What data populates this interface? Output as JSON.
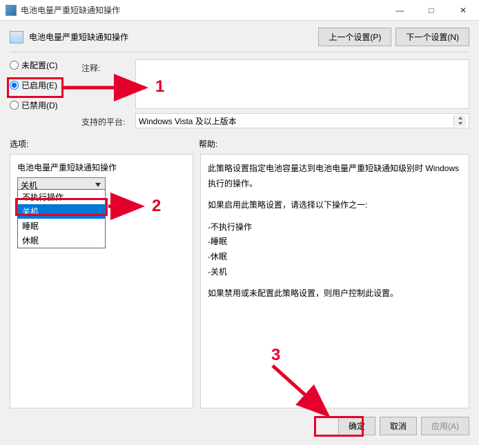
{
  "window": {
    "title": "电池电量严重短缺通知操作",
    "minimize": "—",
    "maximize": "□",
    "close": "✕"
  },
  "header": {
    "title": "电池电量严重短缺通知操作",
    "prev_btn": "上一个设置(P)",
    "next_btn": "下一个设置(N)"
  },
  "radios": {
    "not_configured": "未配置(C)",
    "enabled": "已启用(E)",
    "disabled": "已禁用(D)"
  },
  "fields": {
    "comment_label": "注释:",
    "comment_value": "",
    "platform_label": "支持的平台:",
    "platform_value": "Windows Vista 及以上版本"
  },
  "sections": {
    "options_label": "选项:",
    "help_label": "帮助:"
  },
  "options_panel": {
    "title": "电池电量严重短缺通知操作",
    "combo_selected": "关机",
    "combo_items": [
      "不执行操作",
      "关机",
      "睡眠",
      "休眠"
    ]
  },
  "help_panel": {
    "p1": "此策略设置指定电池容量达到电池电量严重短缺通知级别时 Windows 执行的操作。",
    "p2": "如果启用此策略设置，请选择以下操作之一:",
    "li1": "-不执行操作",
    "li2": "-睡眠",
    "li3": "-休眠",
    "li4": "-关机",
    "p3": "如果禁用或未配置此策略设置，则用户控制此设置。"
  },
  "footer": {
    "ok": "确定",
    "cancel": "取消",
    "apply": "应用(A)"
  },
  "annotations": {
    "n1": "1",
    "n2": "2",
    "n3": "3"
  }
}
